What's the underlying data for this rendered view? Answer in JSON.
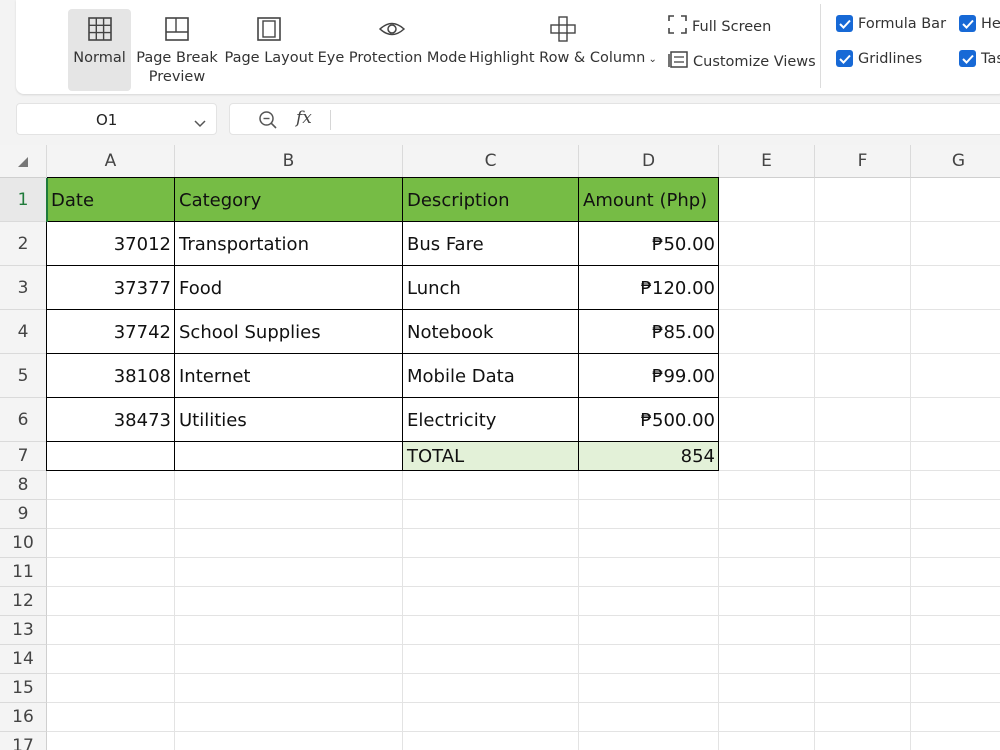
{
  "ribbon": {
    "views": [
      {
        "label": "Normal",
        "icon": "grid-icon"
      },
      {
        "label": "Page Break\nPreview",
        "icon": "page-break-icon"
      },
      {
        "label": "Page Layout",
        "icon": "page-layout-icon"
      },
      {
        "label": "Eye Protection Mode",
        "icon": "eye-icon"
      },
      {
        "label": "Highlight Row & Column",
        "icon": "crosshair-icon"
      }
    ],
    "full_screen": "Full Screen",
    "customize_views": "Customize Views",
    "checkboxes": [
      {
        "label": "Formula Bar",
        "checked": true
      },
      {
        "label": "Gridlines",
        "checked": true
      },
      {
        "label": "He",
        "checked": true
      },
      {
        "label": "Tas",
        "checked": true
      }
    ]
  },
  "name_box": {
    "value": "O1"
  },
  "formula_bar": {
    "fx_label": "fx",
    "value": ""
  },
  "columns": [
    "A",
    "B",
    "C",
    "D",
    "E",
    "F",
    "G"
  ],
  "rows": [
    "1",
    "2",
    "3",
    "4",
    "5",
    "6",
    "7",
    "8",
    "9",
    "10",
    "11",
    "12",
    "13",
    "14",
    "15",
    "16",
    "17"
  ],
  "table": {
    "headers": [
      "Date",
      "Category",
      "Description",
      "Amount (Php)"
    ],
    "rows": [
      [
        "37012",
        "Transportation",
        "Bus Fare",
        "₱50.00"
      ],
      [
        "37377",
        "Food",
        "Lunch",
        "₱120.00"
      ],
      [
        "37742",
        "School Supplies",
        "Notebook",
        "₱85.00"
      ],
      [
        "38108",
        "Internet",
        "Mobile Data",
        "₱99.00"
      ],
      [
        "38473",
        "Utilities",
        "Electricity",
        "₱500.00"
      ]
    ],
    "total_label": "TOTAL",
    "total_value": "854"
  },
  "colors": {
    "header_fill": "#76bc45",
    "total_fill": "#e3f1d8",
    "accent": "#1769d6"
  }
}
